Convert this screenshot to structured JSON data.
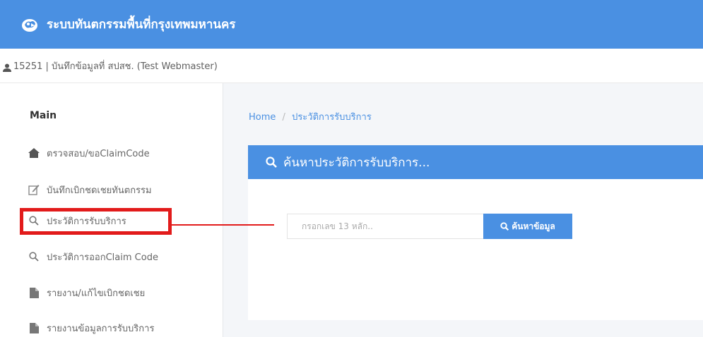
{
  "header": {
    "app_title": "ระบบทันตกรรมพื้นที่กรุงเทพมหานคร",
    "logo_icon": "brand-logo",
    "color": "#4a90e2"
  },
  "user": {
    "icon": "user-icon",
    "text": "15251 | บันทึกข้อมูลที่ สปสช. (Test Webmaster)"
  },
  "sidebar": {
    "heading": "Main",
    "items": [
      {
        "label": "ตรวจสอบ/ขอClaimCode",
        "icon": "home-icon"
      },
      {
        "label": "บันทึกเบิกชดเชยทันตกรรม",
        "icon": "edit-icon"
      },
      {
        "label": "ประวัติการรับบริการ",
        "icon": "search-icon",
        "highlighted": true
      },
      {
        "label": "ประวัติการออกClaim Code",
        "icon": "search-icon"
      },
      {
        "label": "รายงาน/แก้ไขเบิกชดเชย",
        "icon": "file-icon"
      },
      {
        "label": "รายงานข้อมูลการรับบริการ",
        "icon": "file-icon"
      }
    ]
  },
  "breadcrumb": {
    "home": "Home",
    "separator": "/",
    "current": "ประวัติการรับบริการ"
  },
  "panel": {
    "title": "ค้นหาประวัติการรับบริการ...",
    "icon": "search-icon"
  },
  "search": {
    "placeholder": "กรอกเลข 13 หลัก..",
    "value": "",
    "button_label": "ค้นหาข้อมูล",
    "button_icon": "search-icon"
  },
  "annotation_color": "#e21b1b"
}
